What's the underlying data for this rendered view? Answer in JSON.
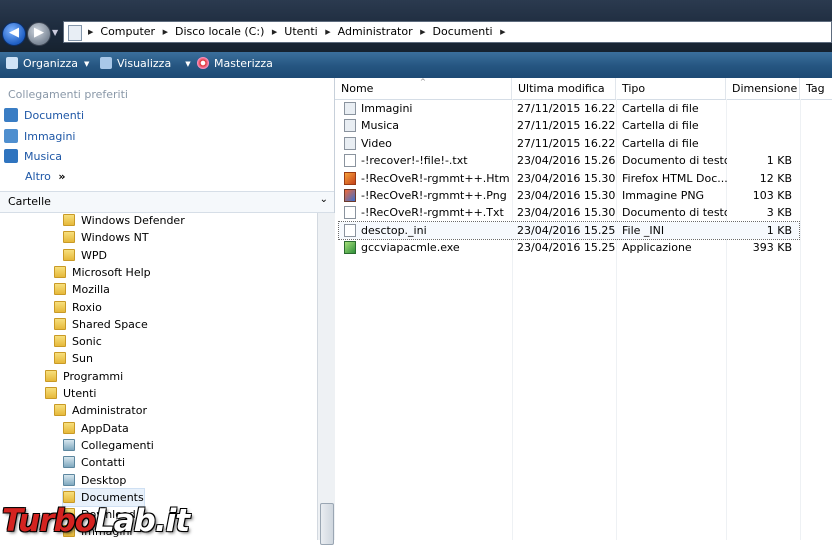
{
  "address": {
    "crumbs": [
      "Computer",
      "Disco locale (C:)",
      "Utenti",
      "Administrator",
      "Documenti"
    ]
  },
  "toolbar": {
    "organize_label": "Organizza",
    "view_label": "Visualizza",
    "burn_label": "Masterizza"
  },
  "favorites": {
    "title": "Collegamenti preferiti",
    "items": [
      "Documenti",
      "Immagini",
      "Musica"
    ],
    "more_label": "Altro",
    "more_glyph": "»"
  },
  "folders": {
    "header": "Cartelle",
    "tree": [
      {
        "label": "Windows Defender",
        "level": 3
      },
      {
        "label": "Windows NT",
        "level": 3
      },
      {
        "label": "WPD",
        "level": 3
      },
      {
        "label": "Microsoft Help",
        "level": 2
      },
      {
        "label": "Mozilla",
        "level": 2
      },
      {
        "label": "Roxio",
        "level": 2
      },
      {
        "label": "Shared Space",
        "level": 2
      },
      {
        "label": "Sonic",
        "level": 2
      },
      {
        "label": "Sun",
        "level": 2
      },
      {
        "label": "Programmi",
        "level": 1
      },
      {
        "label": "Utenti",
        "level": 1
      },
      {
        "label": "Administrator",
        "level": 2
      },
      {
        "label": "AppData",
        "level": 3
      },
      {
        "label": "Collegamenti",
        "level": 3
      },
      {
        "label": "Contatti",
        "level": 3
      },
      {
        "label": "Desktop",
        "level": 3
      },
      {
        "label": "Documents",
        "level": 3
      },
      {
        "label": "Download",
        "level": 3
      },
      {
        "label": "Immagini",
        "level": 3
      }
    ]
  },
  "columns": {
    "name": "Nome",
    "modified": "Ultima modifica",
    "type": "Tipo",
    "size": "Dimensione",
    "tags": "Tag"
  },
  "files": [
    {
      "name": "Immagini",
      "modified": "27/11/2015 16.22",
      "type": "Cartella di file",
      "size": "",
      "icon": "shortcut-folder-icon"
    },
    {
      "name": "Musica",
      "modified": "27/11/2015 16.22",
      "type": "Cartella di file",
      "size": "",
      "icon": "shortcut-folder-icon"
    },
    {
      "name": "Video",
      "modified": "27/11/2015 16.22",
      "type": "Cartella di file",
      "size": "",
      "icon": "shortcut-folder-icon"
    },
    {
      "name": "-!recover!-!file!-.txt",
      "modified": "23/04/2016 15.26",
      "type": "Documento di testo",
      "size": "1 KB",
      "icon": "text-file-icon"
    },
    {
      "name": "-!RecOveR!-rgmmt++.Htm",
      "modified": "23/04/2016 15.30",
      "type": "Firefox HTML Doc...",
      "size": "12 KB",
      "icon": "html-file-icon"
    },
    {
      "name": "-!RecOveR!-rgmmt++.Png",
      "modified": "23/04/2016 15.30",
      "type": "Immagine PNG",
      "size": "103 KB",
      "icon": "png-file-icon"
    },
    {
      "name": "-!RecOveR!-rgmmt++.Txt",
      "modified": "23/04/2016 15.30",
      "type": "Documento di testo",
      "size": "3 KB",
      "icon": "text-file-icon"
    },
    {
      "name": "desctop._ini",
      "modified": "23/04/2016 15.25",
      "type": "File _INI",
      "size": "1 KB",
      "icon": "ini-file-icon"
    },
    {
      "name": "gccviapacmle.exe",
      "modified": "23/04/2016 15.25",
      "type": "Applicazione",
      "size": "393 KB",
      "icon": "exe-file-icon"
    }
  ],
  "watermark": {
    "part1": "Turbo",
    "part2": "Lab.it"
  }
}
